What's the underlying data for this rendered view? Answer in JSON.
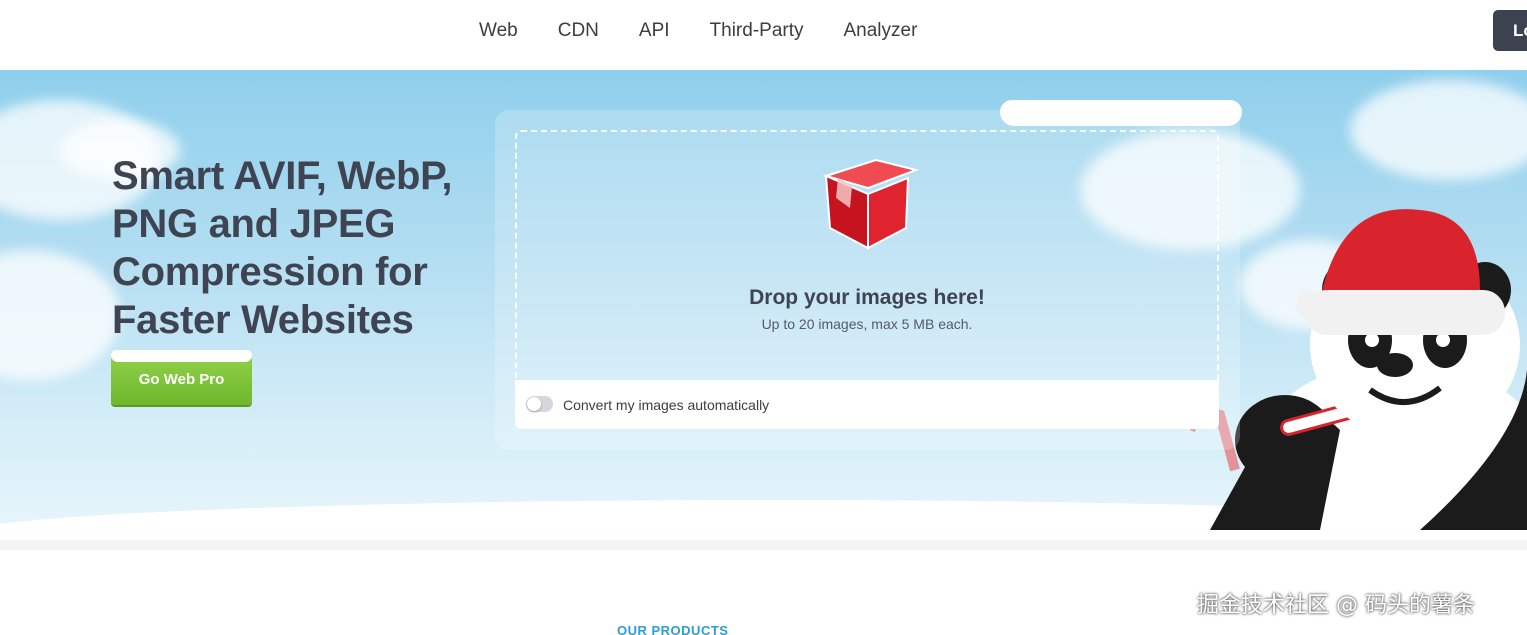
{
  "nav": {
    "items": [
      "Web",
      "CDN",
      "API",
      "Third-Party",
      "Analyzer"
    ],
    "login_label": "Lo"
  },
  "hero": {
    "headline": "Smart AVIF, WebP, PNG and JPEG Compression for Faster Websites",
    "cta_label": "Go Web Pro"
  },
  "dropzone": {
    "title": "Drop your images here!",
    "subtitle": "Up to 20 images, max 5 MB each.",
    "convert_label": "Convert my images automatically",
    "convert_enabled": false
  },
  "products_label": "OUR PRODUCTS",
  "watermark": "掘金技术社区 @ 码头的薯条",
  "colors": {
    "headline": "#3f4452",
    "cta_green": "#7cc23a",
    "login_dark": "#3c4250",
    "products_blue": "#2b9ed4",
    "box_red": "#d9232d"
  }
}
